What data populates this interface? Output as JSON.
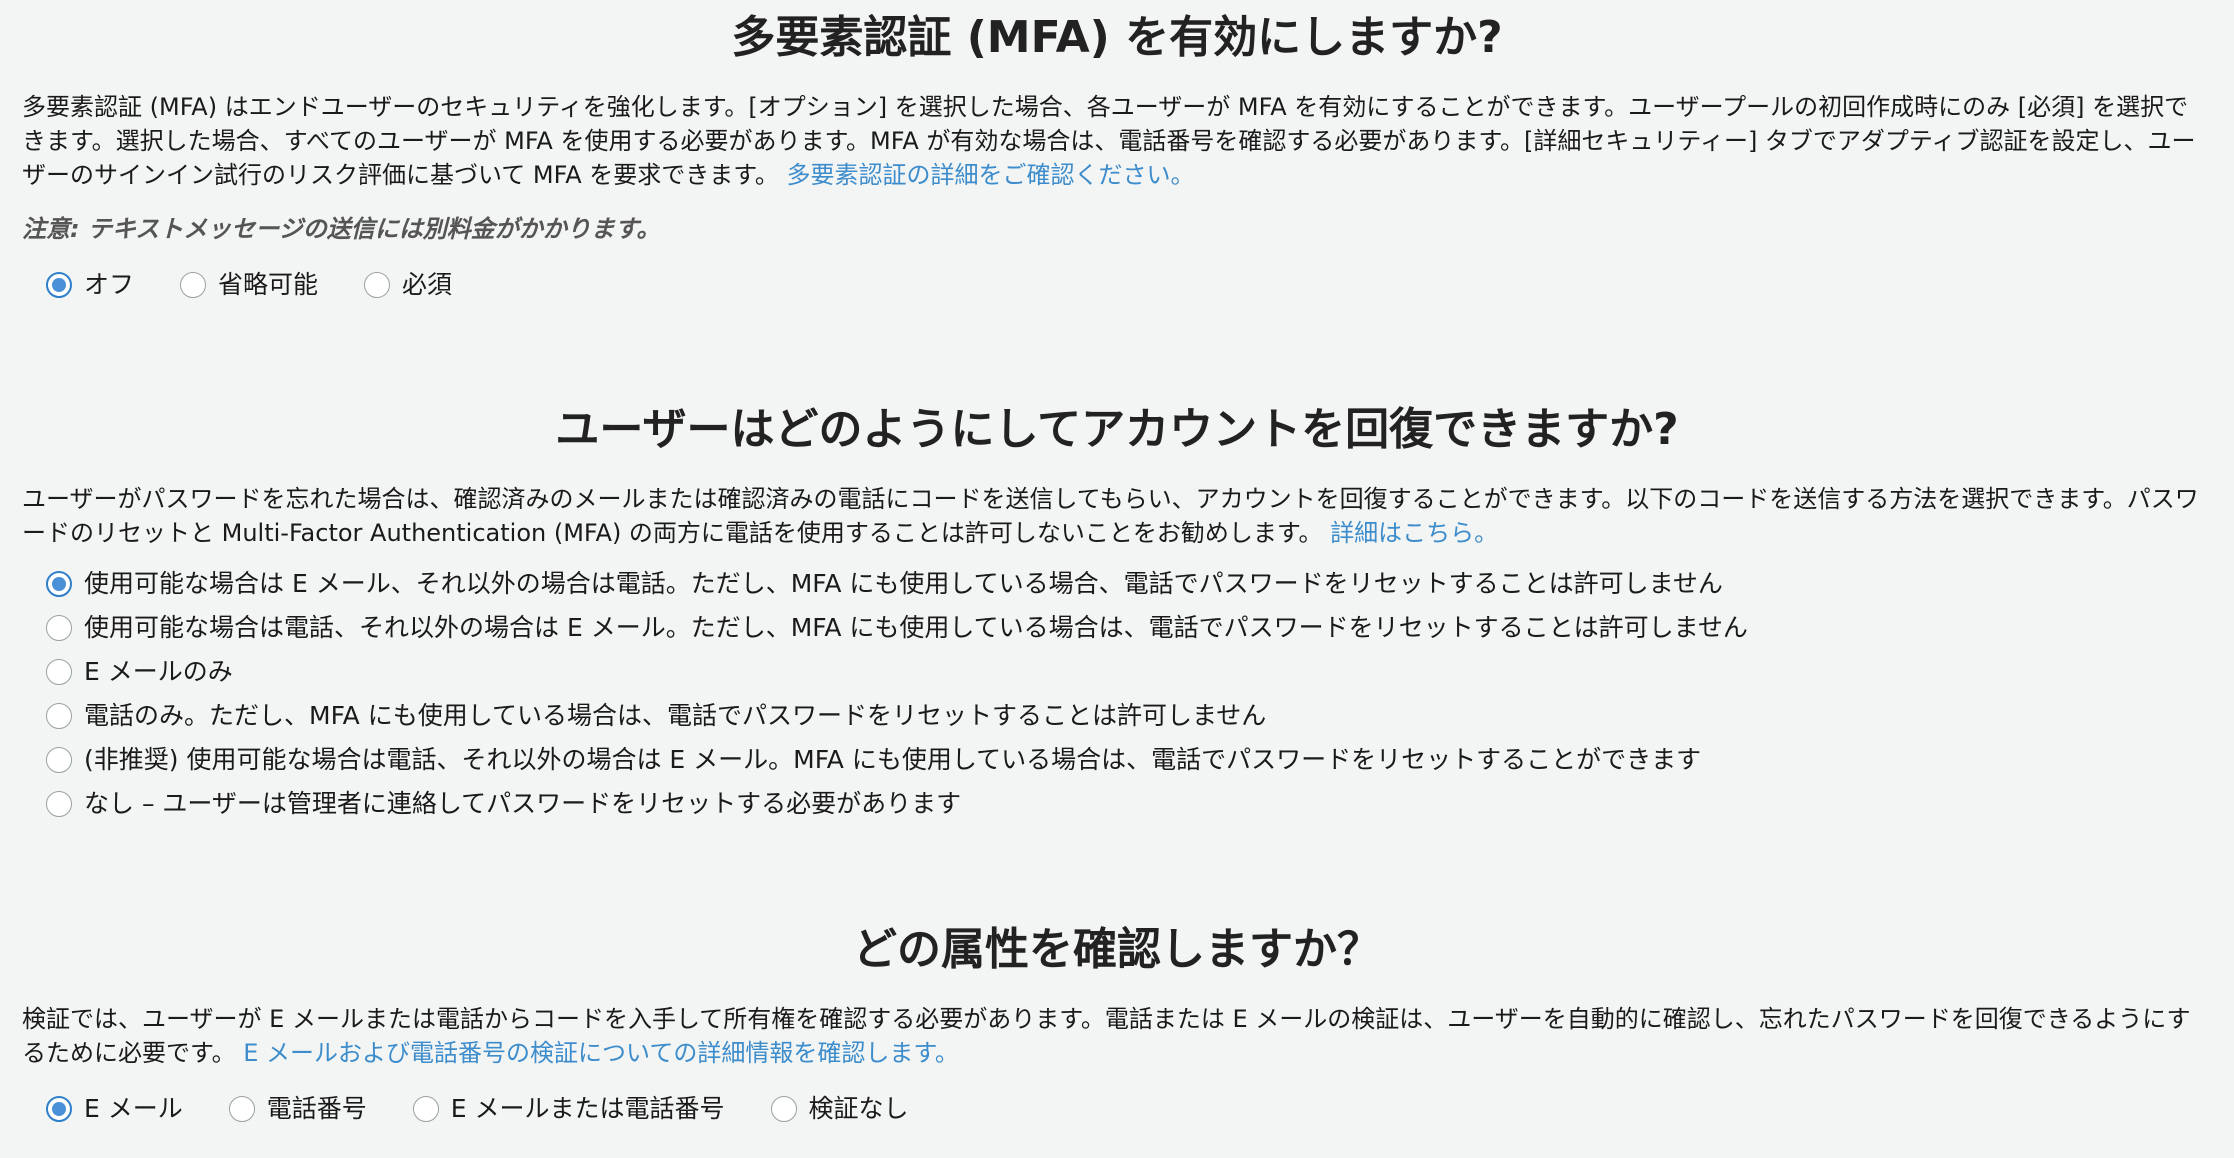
{
  "mfa": {
    "title": "多要素認証 (MFA) を有効にしますか?",
    "description": "多要素認証 (MFA) はエンドユーザーのセキュリティを強化します。[オプション] を選択した場合、各ユーザーが MFA を有効にすることができます。ユーザープールの初回作成時にのみ [必須] を選択できます。選択した場合、すべてのユーザーが MFA を使用する必要があります。MFA が有効な場合は、電話番号を確認する必要があります。[詳細セキュリティー] タブでアダプティブ認証を設定し、ユーザーのサインイン試行のリスク評価に基づいて MFA を要求できます。",
    "link": "多要素認証の詳細をご確認ください。",
    "note": "注意: テキストメッセージの送信には別料金がかかります。",
    "options": [
      {
        "label": "オフ",
        "selected": true
      },
      {
        "label": "省略可能",
        "selected": false
      },
      {
        "label": "必須",
        "selected": false
      }
    ]
  },
  "recovery": {
    "title": "ユーザーはどのようにしてアカウントを回復できますか?",
    "description": "ユーザーがパスワードを忘れた場合は、確認済みのメールまたは確認済みの電話にコードを送信してもらい、アカウントを回復することができます。以下のコードを送信する方法を選択できます。パスワードのリセットと Multi-Factor Authentication (MFA) の両方に電話を使用することは許可しないことをお勧めします。",
    "link": "詳細はこちら。",
    "options": [
      {
        "label": "使用可能な場合は E メール、それ以外の場合は電話。ただし、MFA にも使用している場合、電話でパスワードをリセットすることは許可しません",
        "selected": true
      },
      {
        "label": "使用可能な場合は電話、それ以外の場合は E メール。ただし、MFA にも使用している場合は、電話でパスワードをリセットすることは許可しません",
        "selected": false
      },
      {
        "label": "E メールのみ",
        "selected": false
      },
      {
        "label": "電話のみ。ただし、MFA にも使用している場合は、電話でパスワードをリセットすることは許可しません",
        "selected": false
      },
      {
        "label": "(非推奨) 使用可能な場合は電話、それ以外の場合は E メール。MFA にも使用している場合は、電話でパスワードをリセットすることができます",
        "selected": false
      },
      {
        "label": "なし – ユーザーは管理者に連絡してパスワードをリセットする必要があります",
        "selected": false
      }
    ]
  },
  "verify": {
    "title": "どの属性を確認しますか？",
    "description": "検証では、ユーザーが E メールまたは電話からコードを入手して所有権を確認する必要があります。電話または E メールの検証は、ユーザーを自動的に確認し、忘れたパスワードを回復できるようにするために必要です。",
    "link": "E メールおよび電話番号の検証についての詳細情報を確認します。",
    "options": [
      {
        "label": "E メール",
        "selected": true
      },
      {
        "label": "電話番号",
        "selected": false
      },
      {
        "label": "E メールまたは電話番号",
        "selected": false
      },
      {
        "label": "検証なし",
        "selected": false
      }
    ]
  }
}
